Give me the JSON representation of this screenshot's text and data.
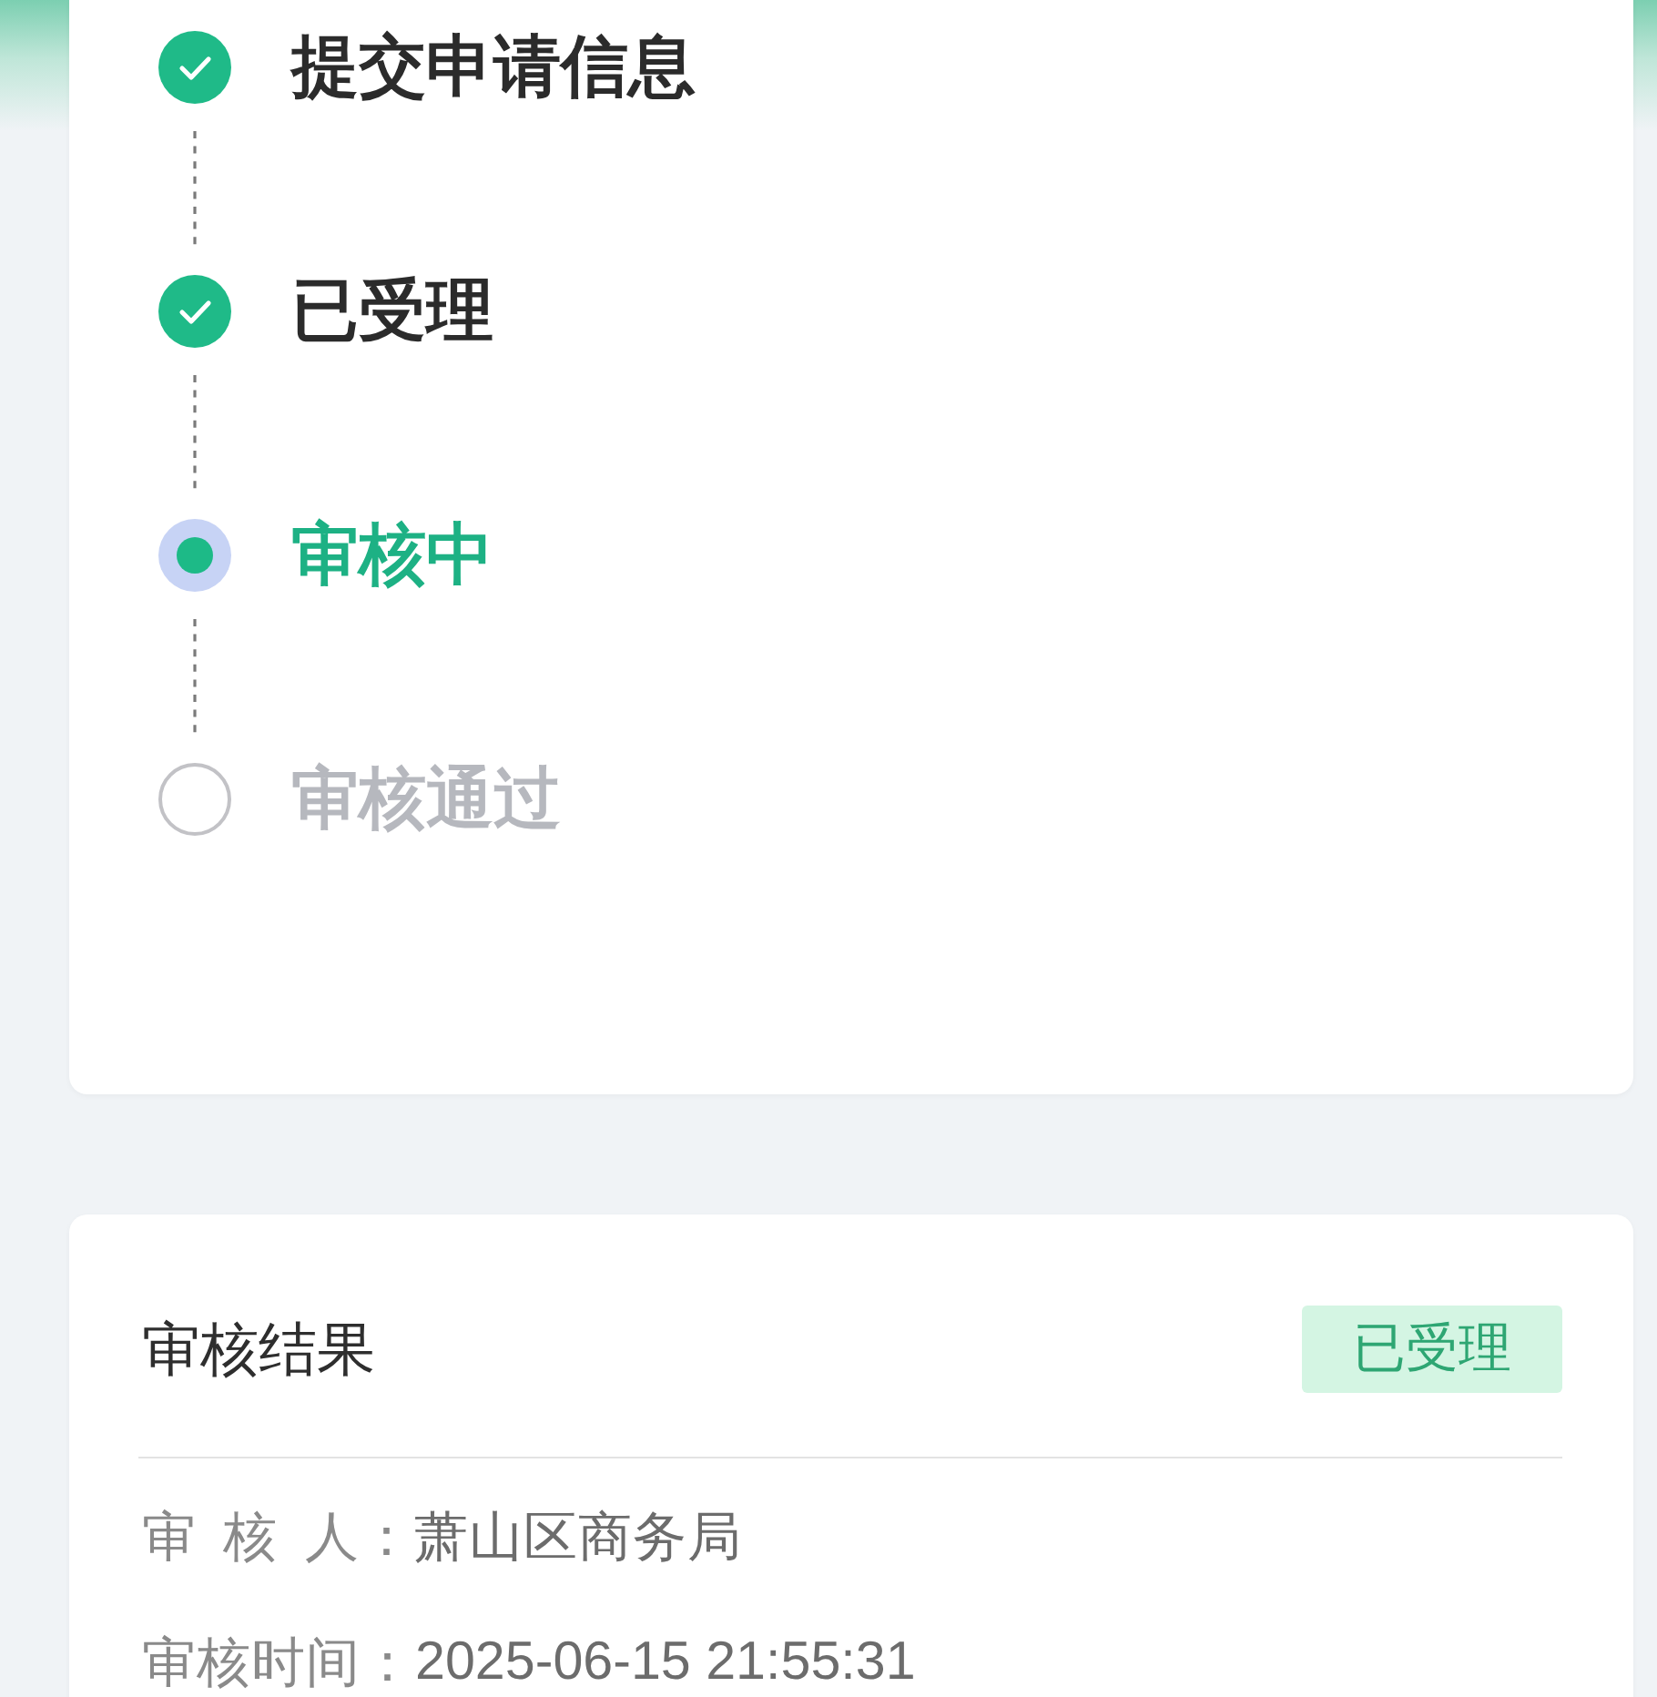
{
  "steps": [
    {
      "label": "提交申请信息",
      "done": true,
      "current": false
    },
    {
      "label": "已受理",
      "done": true,
      "current": false
    },
    {
      "label": "审核中",
      "done": false,
      "current": true
    },
    {
      "label": "审核通过",
      "done": false,
      "current": false
    }
  ],
  "result": {
    "title": "审核结果",
    "badge": "已受理",
    "fields": [
      {
        "label": "审 核 人：",
        "value": "萧山区商务局"
      },
      {
        "label": "审核时间：",
        "value": "2025-06-15 21:55:31"
      }
    ]
  }
}
